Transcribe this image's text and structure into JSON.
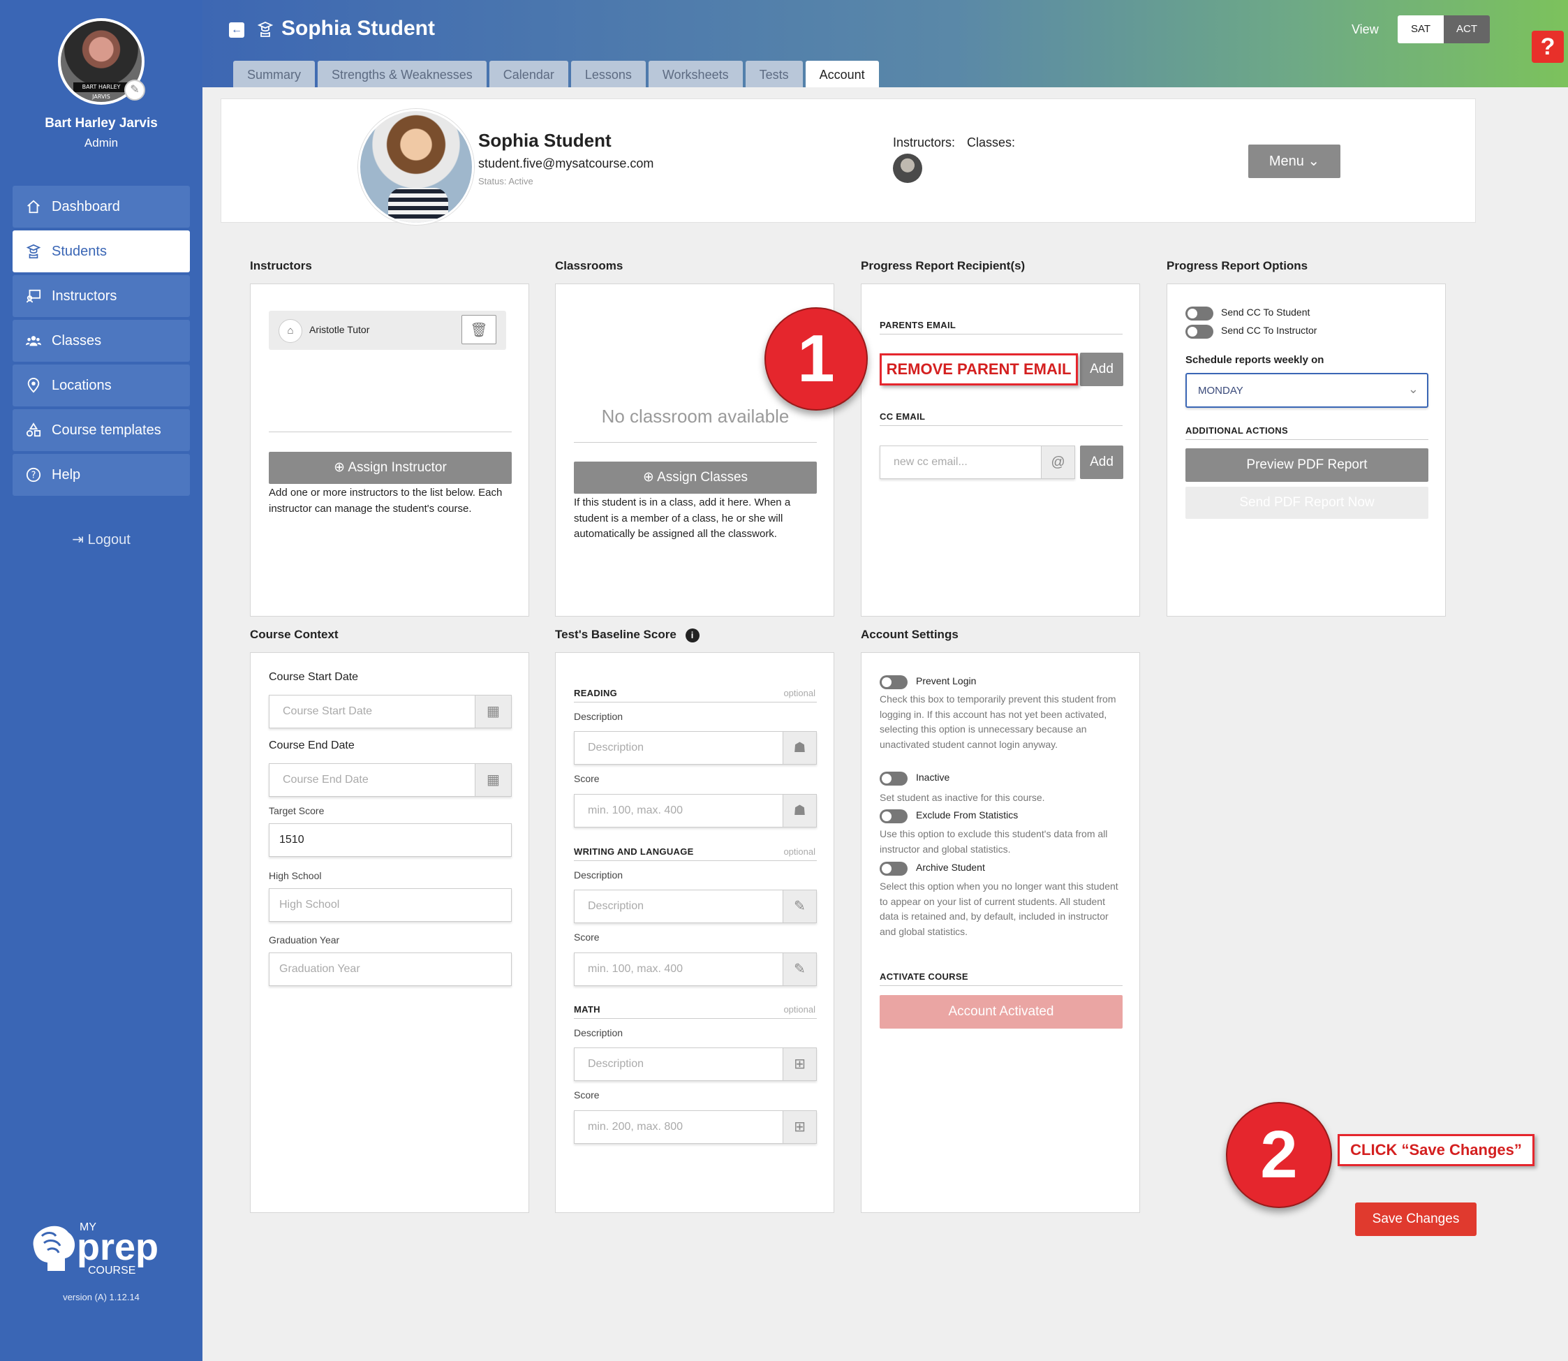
{
  "sidebar": {
    "user_name": "Bart Harley Jarvis",
    "user_role": "Admin",
    "avatar_tag": "BART HARLEY JARVIS",
    "items": [
      {
        "label": "Dashboard",
        "icon": "home-icon"
      },
      {
        "label": "Students",
        "icon": "student-icon"
      },
      {
        "label": "Instructors",
        "icon": "instructor-icon"
      },
      {
        "label": "Classes",
        "icon": "people-icon"
      },
      {
        "label": "Locations",
        "icon": "location-pin-icon"
      },
      {
        "label": "Course templates",
        "icon": "shapes-icon"
      },
      {
        "label": "Help",
        "icon": "question-icon"
      }
    ],
    "logout": "Logout",
    "brand_my": "MY",
    "brand_prep": "prep",
    "brand_course": "COURSE",
    "version": "version (A) 1.12.14"
  },
  "header": {
    "title": "Sophia Student",
    "view_label": "View",
    "view_options": [
      "SAT",
      "ACT"
    ],
    "tabs": [
      "Summary",
      "Strengths & Weaknesses",
      "Calendar",
      "Lessons",
      "Worksheets",
      "Tests",
      "Account"
    ],
    "help": "?"
  },
  "profile": {
    "name": "Sophia Student",
    "email": "student.five@mysatcourse.com",
    "status": "Status: Active",
    "instructors_label": "Instructors:",
    "classes_label": "Classes:",
    "menu_label": "Menu"
  },
  "instructors": {
    "title": "Instructors",
    "item": "Aristotle Tutor",
    "assign_btn": "Assign Instructor",
    "help": "Add one or more instructors to the list below. Each instructor can manage the student's course."
  },
  "classrooms": {
    "title": "Classrooms",
    "empty": "No classroom available",
    "assign_btn": "Assign Classes",
    "help": "If this student is in a class, add it here. When a student is a member of a class, he or she will automatically be assigned all the classwork."
  },
  "recipients": {
    "title": "Progress Report Recipient(s)",
    "parents_label": "PARENTS EMAIL",
    "add": "Add",
    "cc_label": "CC EMAIL",
    "cc_placeholder": "new cc email..."
  },
  "options": {
    "title": "Progress Report Options",
    "cc_student": "Send CC To Student",
    "cc_instructor": "Send CC To Instructor",
    "schedule_label": "Schedule reports weekly on",
    "schedule_value": "MONDAY",
    "additional": "ADDITIONAL ACTIONS",
    "preview_btn": "Preview PDF Report",
    "send_btn": "Send PDF Report Now"
  },
  "course_context": {
    "title": "Course Context",
    "start_label": "Course Start Date",
    "start_ph": "Course Start Date",
    "end_label": "Course End Date",
    "end_ph": "Course End Date",
    "target_label": "Target Score",
    "target_value": "1510",
    "school_label": "High School",
    "school_ph": "High School",
    "grad_label": "Graduation Year",
    "grad_ph": "Graduation Year"
  },
  "baseline": {
    "title": "Test's Baseline Score",
    "sections": [
      {
        "name": "READING",
        "optional": "optional",
        "desc_label": "Description",
        "desc_ph": "Description",
        "score_label": "Score",
        "score_ph": "min. 100, max. 400"
      },
      {
        "name": "WRITING AND LANGUAGE",
        "optional": "optional",
        "desc_label": "Description",
        "desc_ph": "Description",
        "score_label": "Score",
        "score_ph": "min. 100, max. 400"
      },
      {
        "name": "MATH",
        "optional": "optional",
        "desc_label": "Description",
        "desc_ph": "Description",
        "score_label": "Score",
        "score_ph": "min. 200, max. 800"
      }
    ]
  },
  "account": {
    "title": "Account Settings",
    "prevent": "Prevent Login",
    "prevent_desc": "Check this box to temporarily prevent this student from logging in. If this account has not yet been activated, selecting this option is unnecessary because an unactivated student cannot login anyway.",
    "inactive": "Inactive",
    "inactive_desc": "Set student as inactive for this course.",
    "exclude": "Exclude From Statistics",
    "exclude_desc": "Use this option to exclude this student's data from all instructor and global statistics.",
    "archive": "Archive Student",
    "archive_desc": "Select this option when you no longer want this student to appear on your list of current students. All student data is retained and, by default, included in instructor and global statistics.",
    "activate_label": "ACTIVATE COURSE",
    "activated_btn": "Account Activated"
  },
  "annotations": {
    "step1": "1",
    "step1_box": "REMOVE PARENT EMAIL",
    "step2": "2",
    "step2_box": "CLICK “Save Changes”"
  },
  "save_btn": "Save Changes",
  "colors": {
    "sidebar": "#3a66b5",
    "accent_red": "#e5262d",
    "save": "#e03a2e",
    "activated": "#eaa5a3"
  }
}
